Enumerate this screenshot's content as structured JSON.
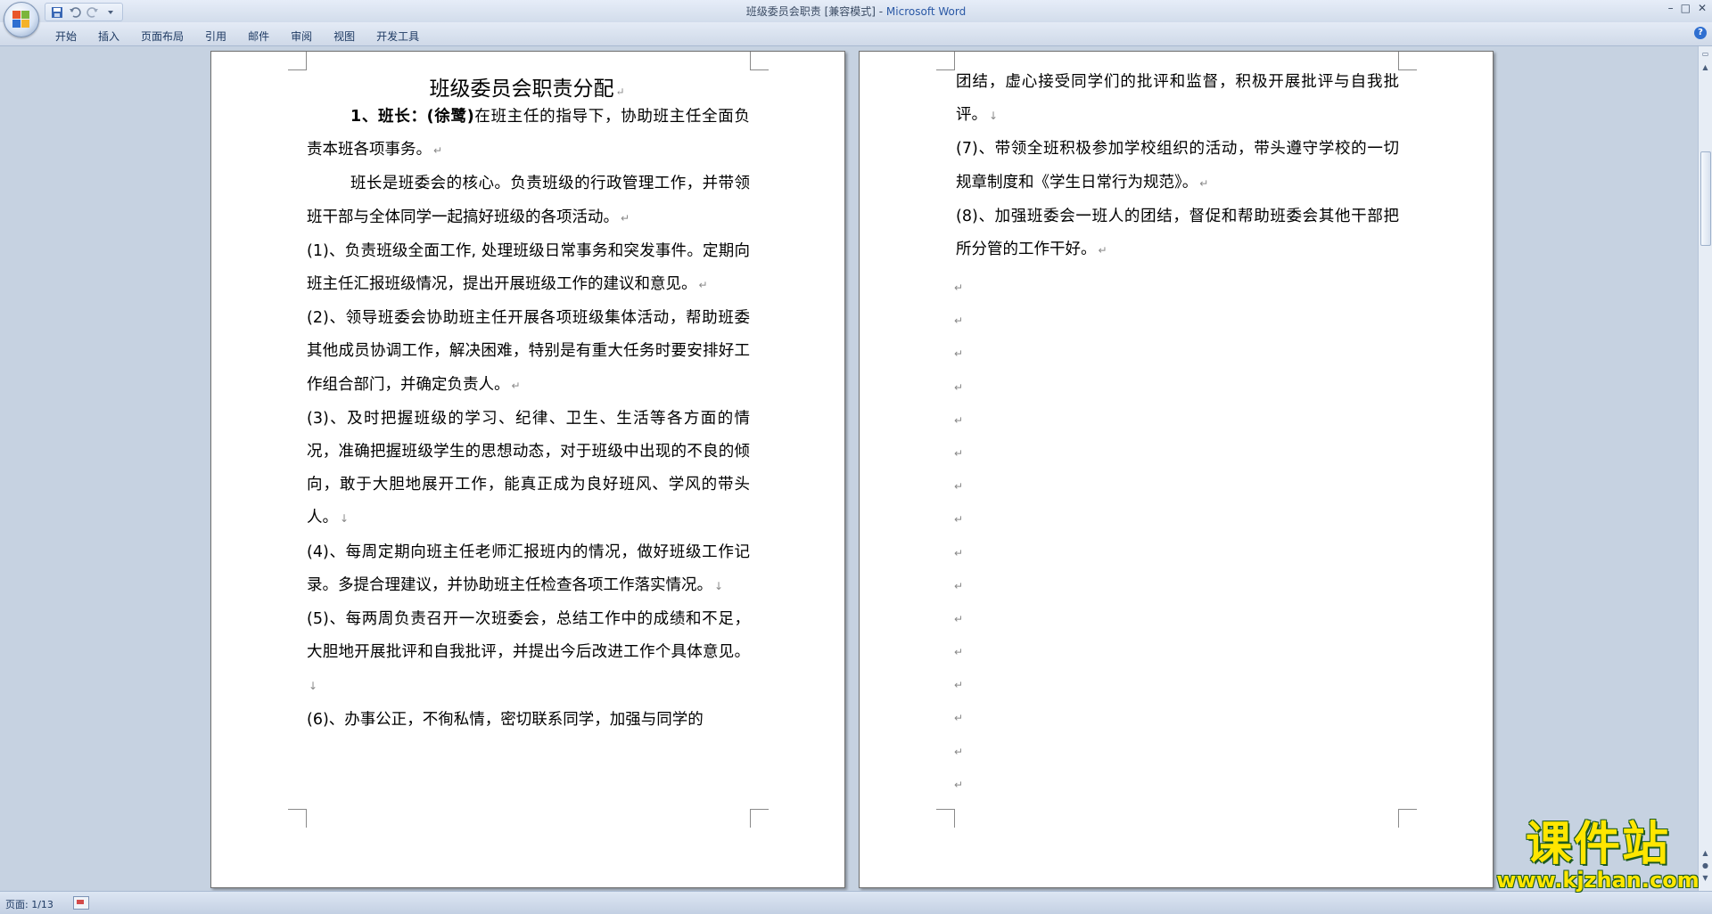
{
  "window": {
    "title": "班级委员会职责 [兼容模式] - ",
    "app_name": "Microsoft Word",
    "controls": [
      "–",
      "□",
      "✕"
    ]
  },
  "ribbon": {
    "tabs": [
      "开始",
      "插入",
      "页面布局",
      "引用",
      "邮件",
      "审阅",
      "视图",
      "开发工具"
    ],
    "help": "?"
  },
  "document": {
    "title": "班级委员会职责分配",
    "page1": [
      {
        "lead": "1、班长：(徐鹭)",
        "text": "在班主任的指导下，协助班主任全面负责本班各项事务。",
        "indent": true
      },
      {
        "text": "班长是班委会的核心。负责班级的行政管理工作，并带领班干部与全体同学一起搞好班级的各项活动。",
        "indent": true
      },
      {
        "text": "(1)、负责班级全面工作, 处理班级日常事务和突发事件。定期向班主任汇报班级情况，提出开展班级工作的建议和意见。",
        "indent": false
      },
      {
        "text": "(2)、领导班委会协助班主任开展各项班级集体活动，帮助班委其他成员协调工作，解决困难，特别是有重大任务时要安排好工作组合部门，并确定负责人。",
        "indent": false
      },
      {
        "text": "(3)、及时把握班级的学习、纪律、卫生、生活等各方面的情况，准确把握班级学生的思想动态，对于班级中出现的不良的倾向，敢于大胆地展开工作，能真正成为良好班风、学风的带头人。",
        "indent": false
      },
      {
        "text": "(4)、每周定期向班主任老师汇报班内的情况，做好班级工作记录。多提合理建议，并协助班主任检查各项工作落实情况。",
        "indent": false
      },
      {
        "text": "(5)、每两周负责召开一次班委会，总结工作中的成绩和不足，大胆地开展批评和自我批评，并提出今后改进工作个具体意见。",
        "indent": false
      },
      {
        "text": "(6)、办事公正，不徇私情，密切联系同学，加强与同学的",
        "indent": false
      }
    ],
    "page2": [
      {
        "text": "团结，虚心接受同学们的批评和监督，积极开展批评与自我批评。"
      },
      {
        "text": "(7)、带领全班积极参加学校组织的活动，带头遵守学校的一切规章制度和《学生日常行为规范》。"
      },
      {
        "text": "(8)、加强班委会一班人的团结，督促和帮助班委会其他干部把所分管的工作干好。"
      }
    ],
    "paragraph_mark": "↵",
    "line_break_mark": "↓"
  },
  "status": {
    "page": "页面: 1/13"
  },
  "watermark": {
    "name": "课件站",
    "url": "www.kjzhan.com"
  },
  "colors": {
    "title_app": "#2a58a5",
    "watermark_fill": "#ffe600",
    "watermark_outline": "#1c5a1f"
  }
}
